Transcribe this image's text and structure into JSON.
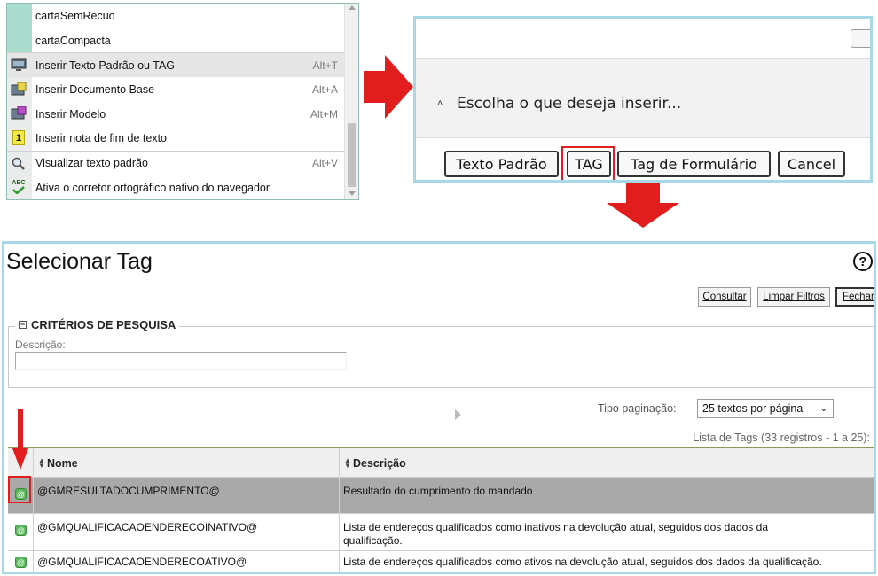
{
  "menu": {
    "items": [
      {
        "label": "cartaSemRecuo",
        "shortcut": "",
        "icon": "none"
      },
      {
        "label": "cartaCompacta",
        "shortcut": "",
        "icon": "none"
      },
      {
        "label": "Inserir Texto Padrão ou TAG",
        "shortcut": "Alt+T",
        "icon": "monitor-icon"
      },
      {
        "label": "Inserir Documento Base",
        "shortcut": "Alt+A",
        "icon": "document-base-icon"
      },
      {
        "label": "Inserir Modelo",
        "shortcut": "Alt+M",
        "icon": "template-icon"
      },
      {
        "label": "Inserir nota de fim de texto",
        "shortcut": "",
        "icon": "footnote-icon"
      },
      {
        "label": "Visualizar texto padrão",
        "shortcut": "Alt+V",
        "icon": "magnifier-icon"
      },
      {
        "label": "Ativa o corretor ortográfico nativo do navegador",
        "shortcut": "",
        "icon": "spellcheck-icon"
      }
    ],
    "footnote_glyph": "1",
    "spell_glyph": "ABC"
  },
  "dialog": {
    "chevron": "˄",
    "prompt": "Escolha o que deseja inserir...",
    "buttons": {
      "texto_padrao": "Texto Padrão",
      "tag": "TAG",
      "tag_formulario": "Tag de Formulário",
      "cancel": "Cancel"
    }
  },
  "panel": {
    "title": "Selecionar Tag",
    "help": "?",
    "toolbar": {
      "consultar": "Consultar",
      "limpar": "Limpar Filtros",
      "fechar": "Fechar"
    },
    "criteria": {
      "legend": "CRITÉRIOS DE PESQUISA",
      "toggle": "−",
      "descricao_label": "Descrição:",
      "descricao_value": ""
    },
    "pagination": {
      "label": "Tipo paginação:",
      "selected": "25 textos por página",
      "dropdown": "⌄"
    },
    "list_info": "Lista de Tags (33 registros - 1 a 25):",
    "columns": {
      "sort_glyph": "▲▼",
      "nome": "Nome",
      "descricao": "Descrição"
    },
    "rows": [
      {
        "nome": "@GMRESULTADOCUMPRIMENTO@",
        "descricao": "Resultado do cumprimento do mandado",
        "selected": true
      },
      {
        "nome": "@GMQUALIFICACAOENDERECOINATIVO@",
        "descricao": "Lista de endereços qualificados como inativos na devolução atual, seguidos dos dados da qualificação.",
        "selected": false
      },
      {
        "nome": "@GMQUALIFICACAOENDERECOATIVO@",
        "descricao": "Lista de endereços qualificados como ativos na devolução atual, seguidos dos dados da qualificação.",
        "selected": false
      }
    ],
    "row_icon_glyph": "@"
  },
  "colors": {
    "highlight": "#e11d1d",
    "frame": "#a6d8e6",
    "arrow": "#e11d1d",
    "selected_row": "#a9a9a9",
    "tag_icon": "#5cb85c"
  }
}
